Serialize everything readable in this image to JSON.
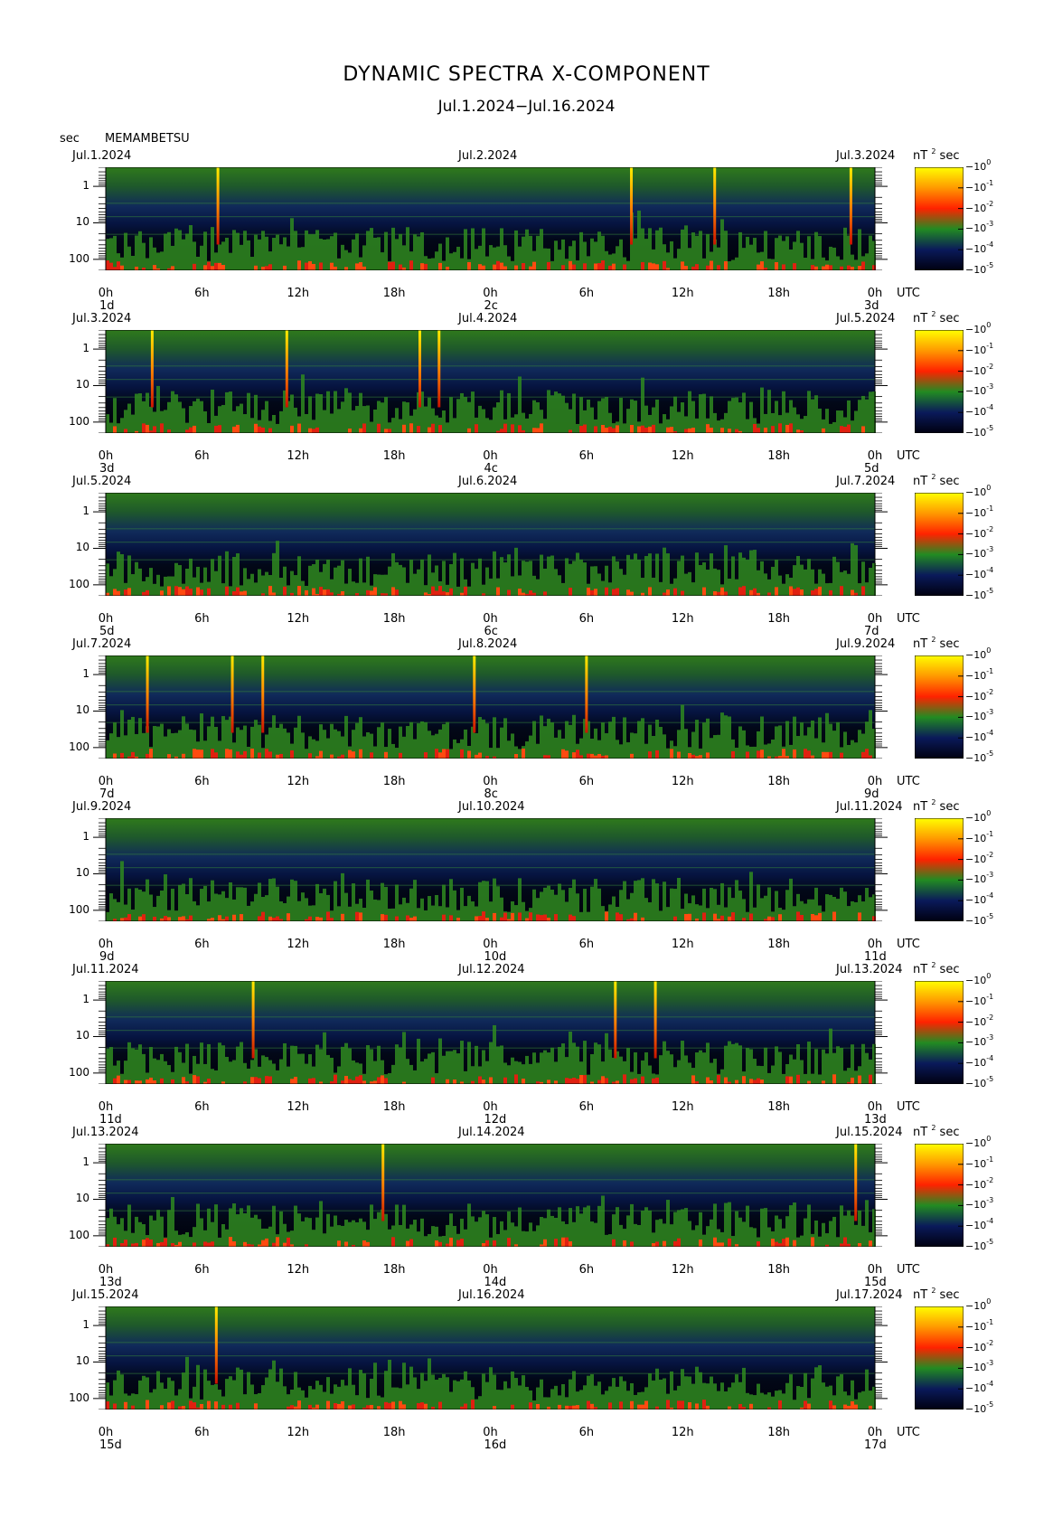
{
  "header": {
    "title": "DYNAMIC SPECTRA X-COMPONENT",
    "subtitle": "Jul.1.2024−Jul.16.2024",
    "sec_label": "sec",
    "station": "MEMAMBETSU"
  },
  "colorbar": {
    "unit_prefix": "nT",
    "unit_suffix": "sec",
    "unit_exp": "2",
    "base": "10",
    "exponents": [
      "0",
      "-1",
      "-2",
      "-3",
      "-4",
      "-5"
    ],
    "colors": [
      "#ffff00",
      "#ff9900",
      "#ff2200",
      "#228b22",
      "#0a1a5a",
      "#000010"
    ]
  },
  "axis": {
    "x_ticks": [
      "0h",
      "6h",
      "12h",
      "18h",
      "0h",
      "6h",
      "12h",
      "18h",
      "0h"
    ],
    "utc_label": "UTC",
    "y_ticks": [
      "1",
      "10",
      "100"
    ]
  },
  "chart_data": {
    "type": "heatmap",
    "title": "DYNAMIC SPECTRA X-COMPONENT",
    "ylabel": "sec",
    "y_scale": "log",
    "ylim_sec": [
      0.3,
      200
    ],
    "panels": [
      {
        "start": "Jul.1.2024",
        "mid": "Jul.2.2024",
        "end": "Jul.3.2024",
        "d_left": "1d",
        "d_mid": "2c",
        "d_right": "3d",
        "spikes_hour": [
          7.0,
          32.8,
          38.0,
          46.5
        ]
      },
      {
        "start": "Jul.3.2024",
        "mid": "Jul.4.2024",
        "end": "Jul.5.2024",
        "d_left": "3d",
        "d_mid": "4c",
        "d_right": "5d",
        "spikes_hour": [
          2.9,
          11.3,
          19.6,
          20.8
        ]
      },
      {
        "start": "Jul.5.2024",
        "mid": "Jul.6.2024",
        "end": "Jul.7.2024",
        "d_left": "5d",
        "d_mid": "6c",
        "d_right": "7d",
        "spikes_hour": []
      },
      {
        "start": "Jul.7.2024",
        "mid": "Jul.8.2024",
        "end": "Jul.9.2024",
        "d_left": "7d",
        "d_mid": "8c",
        "d_right": "9d",
        "spikes_hour": [
          2.6,
          7.9,
          9.8,
          23.0,
          30.0
        ]
      },
      {
        "start": "Jul.9.2024",
        "mid": "Jul.10.2024",
        "end": "Jul.11.2024",
        "d_left": "9d",
        "d_mid": "10d",
        "d_right": "11d",
        "spikes_hour": []
      },
      {
        "start": "Jul.11.2024",
        "mid": "Jul.12.2024",
        "end": "Jul.13.2024",
        "d_left": "11d",
        "d_mid": "12d",
        "d_right": "13d",
        "spikes_hour": [
          9.2,
          31.8,
          34.3
        ]
      },
      {
        "start": "Jul.13.2024",
        "mid": "Jul.14.2024",
        "end": "Jul.15.2024",
        "d_left": "13d",
        "d_mid": "14d",
        "d_right": "15d",
        "spikes_hour": [
          17.3,
          46.8
        ]
      },
      {
        "start": "Jul.15.2024",
        "mid": "Jul.16.2024",
        "end": "Jul.17.2024",
        "d_left": "15d",
        "d_mid": "16d",
        "d_right": "17d",
        "spikes_hour": [
          6.9
        ]
      }
    ]
  }
}
